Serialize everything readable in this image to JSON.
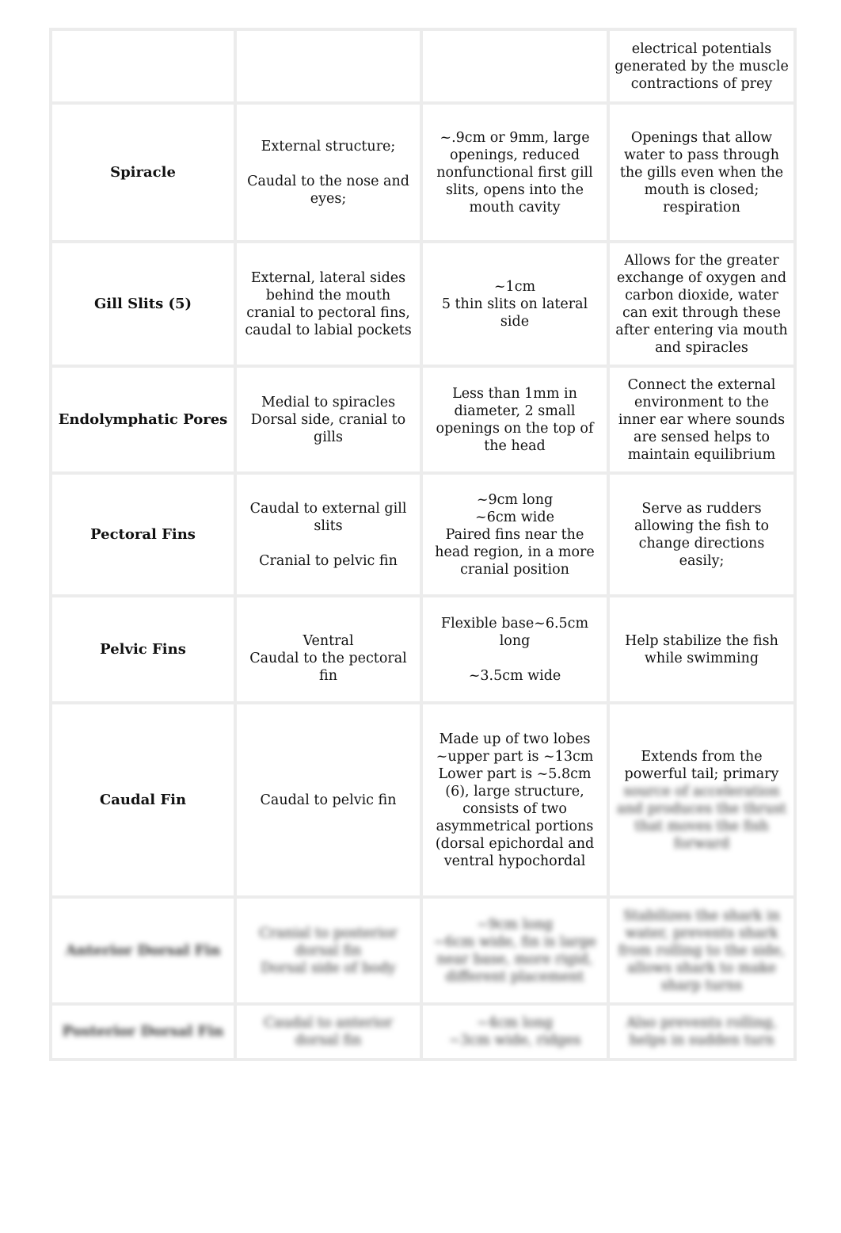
{
  "rows": [
    {
      "structure": "",
      "location": "",
      "description": "",
      "function": "electrical potentials generated by the muscle contractions of prey"
    },
    {
      "structure": "Spiracle",
      "location": "External structure;\n\nCaudal to the nose and eyes;",
      "description": "~.9cm or 9mm, large openings, reduced nonfunctional first gill slits, opens into the mouth cavity",
      "function": "Openings that allow water to pass through the gills even when the mouth is closed; respiration"
    },
    {
      "structure": "Gill Slits (5)",
      "location": "External, lateral sides behind the mouth cranial to pectoral fins, caudal to labial pockets",
      "description": "~1cm\n5 thin slits on lateral side",
      "function": "Allows for the greater exchange of oxygen and carbon dioxide, water can exit through these after entering via mouth and spiracles"
    },
    {
      "structure": "Endolymphatic Pores",
      "location": "Medial to spiracles\nDorsal side, cranial to gills",
      "description": "Less than 1mm in diameter, 2 small openings on the top of the head",
      "function": "Connect the external environment to the inner ear where sounds are sensed helps to maintain equilibrium"
    },
    {
      "structure": "Pectoral Fins",
      "location": "Caudal to external gill slits\n\nCranial to pelvic fin",
      "description": "~9cm long\n~6cm wide\nPaired fins near the head region, in a more cranial position",
      "function": "Serve as rudders allowing the fish to change directions easily;"
    },
    {
      "structure": "Pelvic Fins",
      "location": "\nVentral\nCaudal to the pectoral fin",
      "description": "Flexible base~6.5cm long\n\n~3.5cm wide",
      "function": "Help stabilize the fish while swimming"
    },
    {
      "structure": "Caudal Fin",
      "location": "Caudal to pelvic fin",
      "description": "Made up of two lobes ~upper part is ~13cm\nLower part is ~5.8cm (6), large structure, consists of two asymmetrical portions (dorsal epichordal and ventral hypochordal",
      "function": "Extends from the powerful tail; primary"
    }
  ],
  "blurred": {
    "caudal_function_rest": "source of acceleration and produces the thrust that moves the fish forward",
    "rows": [
      {
        "structure": "Anterior Dorsal Fin",
        "location": "Cranial to posterior dorsal fin\nDorsal side of body",
        "description": "~9cm long\n~6cm wide, fin is large near base, more rigid, different placement",
        "function": "Stabilizes the shark in water, prevents shark from rolling to the side, allows shark to make sharp turns"
      },
      {
        "structure": "Posterior Dorsal Fin",
        "location": "Caudal to anterior dorsal fin",
        "description": "~4cm long\n~3cm wide, ridges",
        "function": "Also prevents rolling, helps in sudden turn"
      }
    ]
  }
}
